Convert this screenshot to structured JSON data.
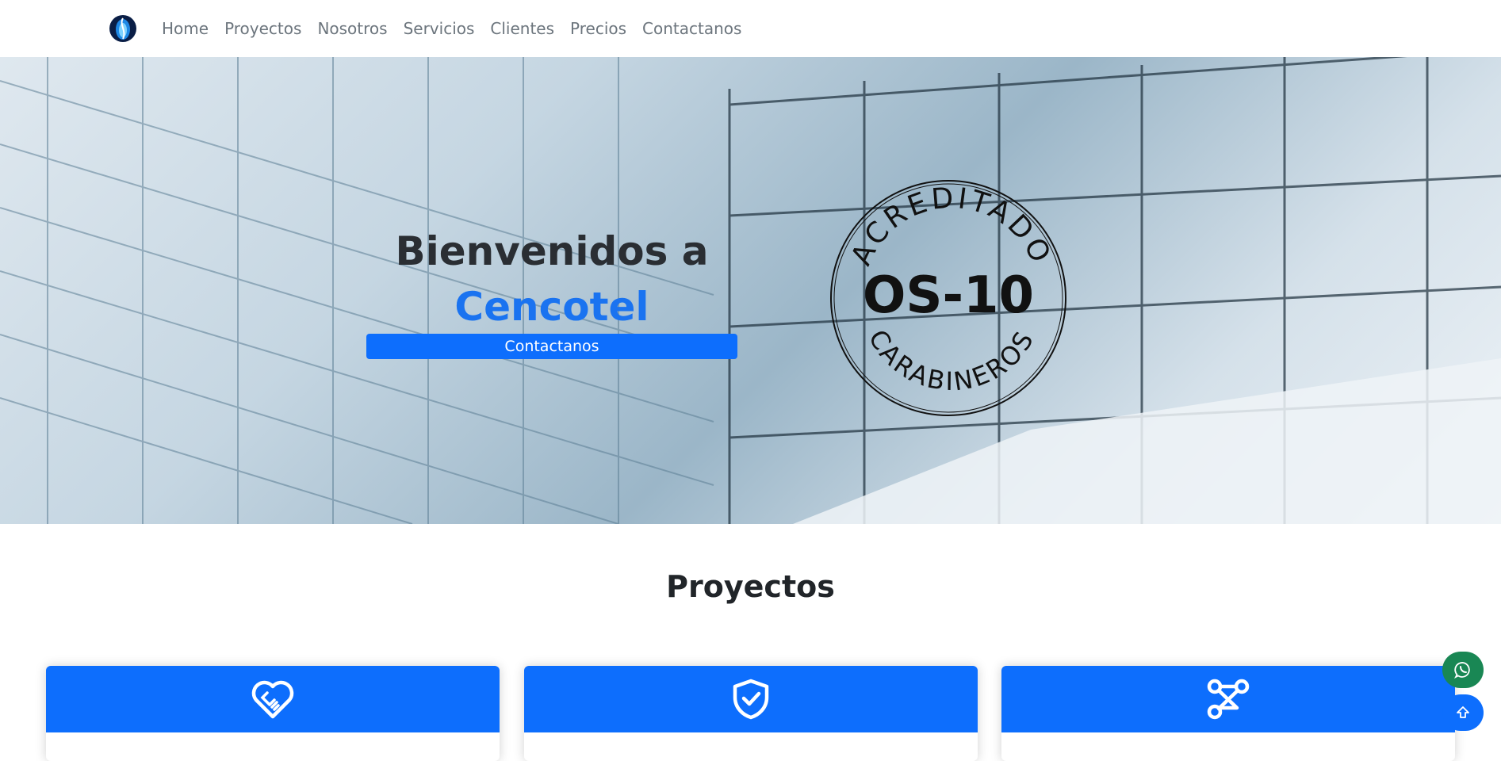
{
  "navbar": {
    "logo_icon": "cencotel-logo-icon",
    "links": [
      "Home",
      "Proyectos",
      "Nosotros",
      "Servicios",
      "Clientes",
      "Precios",
      "Contactanos"
    ]
  },
  "hero": {
    "title": "Bienvenidos a",
    "brand": "Cencotel",
    "cta_label": "Contactanos",
    "seal": {
      "top_text": "ACREDITADO",
      "center_text": "OS-10",
      "bottom_text": "CARABINEROS"
    }
  },
  "projects": {
    "title": "Proyectos",
    "cards": [
      {
        "icon": "heart-handshake-icon"
      },
      {
        "icon": "shield-check-icon"
      },
      {
        "icon": "connections-icon"
      }
    ]
  },
  "floating": {
    "whatsapp_icon": "whatsapp-icon",
    "scroll_top_icon": "arrow-up-icon"
  },
  "colors": {
    "primary": "#0d6efd",
    "brand_text": "#1a73f0",
    "whatsapp": "#198754",
    "nav_text": "#6c757d"
  }
}
